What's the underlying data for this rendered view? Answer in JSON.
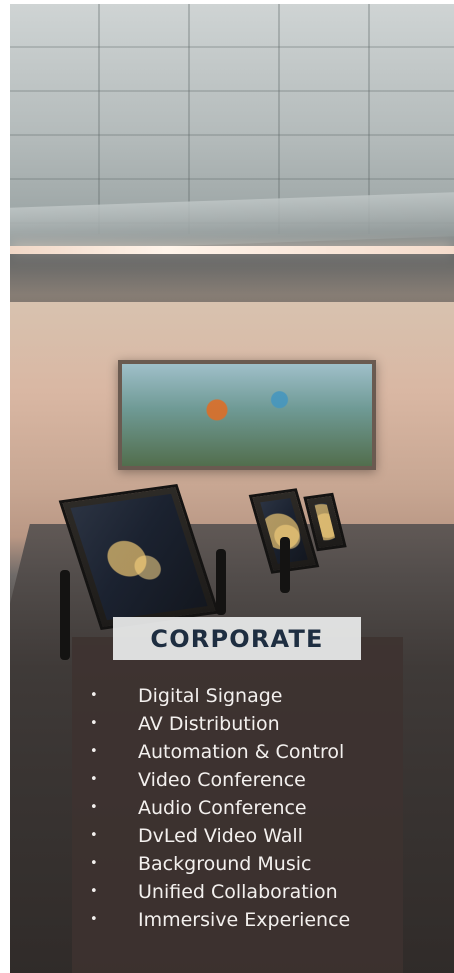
{
  "heading": {
    "title": "CORPORATE"
  },
  "services": [
    "Digital Signage",
    "AV Distribution",
    "Automation & Control",
    "Video Conference",
    "Audio Conference",
    "DvLed Video Wall",
    "Background Music",
    "Unified Collaboration",
    "Immersive Experience"
  ],
  "ui": {
    "bullet_symbol": "•"
  },
  "colors": {
    "heading_text": "#1e2e41",
    "heading_background": "#e8e9e9",
    "panel_background": "#3e3230",
    "list_text": "#f3f0ee"
  }
}
